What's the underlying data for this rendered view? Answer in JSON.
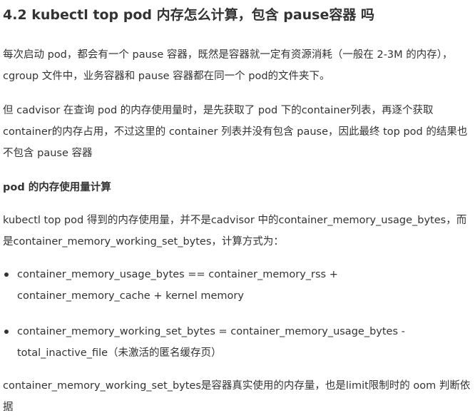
{
  "article": {
    "title": "4.2 kubectl top pod 内存怎么计算，包含 pause容器 吗",
    "paragraph_1": "每次启动 pod，都会有一个 pause 容器，既然是容器就一定有资源消耗（一般在 2-3M 的内存），cgroup 文件中，业务容器和 pause 容器都在同一个 pod的文件夹下。",
    "paragraph_2": "但 cadvisor 在查询 pod 的内存使用量时，是先获取了 pod 下的container列表，再逐个获取container的内存占用，不过这里的 container 列表并没有包含 pause，因此最终 top pod 的结果也不包含 pause 容器",
    "subheading": "pod 的内存使用量计算",
    "paragraph_3": "kubectl top pod 得到的内存使用量，并不是cadvisor 中的container_memory_usage_bytes，而是container_memory_working_set_bytes，计算方式为：",
    "bullets": [
      "container_memory_usage_bytes == container_memory_rss + container_memory_cache + kernel memory",
      "container_memory_working_set_bytes = container_memory_usage_bytes - total_inactive_file（未激活的匿名缓存页）"
    ],
    "paragraph_4": "container_memory_working_set_bytes是容器真实使用的内存量，也是limit限制时的 oom 判断依据"
  }
}
